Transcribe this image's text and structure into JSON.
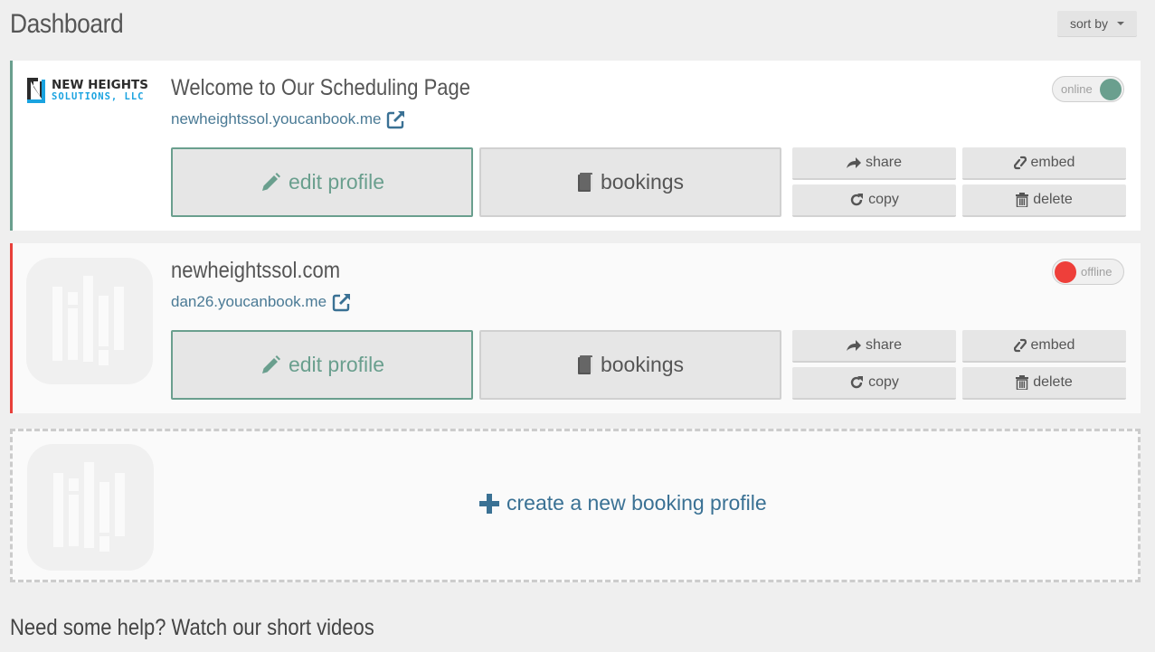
{
  "header": {
    "title": "Dashboard",
    "sort_label": "sort by"
  },
  "profiles": [
    {
      "status": "online",
      "status_color": "#6a9f8e",
      "brand_line1": "NEW HEIGHTS",
      "brand_line2": "SOLUTIONS, LLC",
      "title": "Welcome to Our Scheduling Page",
      "link": "newheightssol.youcanbook.me",
      "toggle_label": "online",
      "edit_label": "edit profile",
      "bookings_label": "bookings",
      "share_label": "share",
      "embed_label": "embed",
      "copy_label": "copy",
      "delete_label": "delete"
    },
    {
      "status": "offline",
      "status_color": "#ee3f3a",
      "title": "newheightssol.com",
      "link": "dan26.youcanbook.me",
      "toggle_label": "offline",
      "edit_label": "edit profile",
      "bookings_label": "bookings",
      "share_label": "share",
      "embed_label": "embed",
      "copy_label": "copy",
      "delete_label": "delete"
    }
  ],
  "create": {
    "label": "create a new booking profile"
  },
  "footer": {
    "help_text": "Need some help? Watch our short videos"
  },
  "colors": {
    "accent_green": "#6a9f8e",
    "offline_red": "#ee3f3a",
    "link_blue": "#3a7194"
  }
}
